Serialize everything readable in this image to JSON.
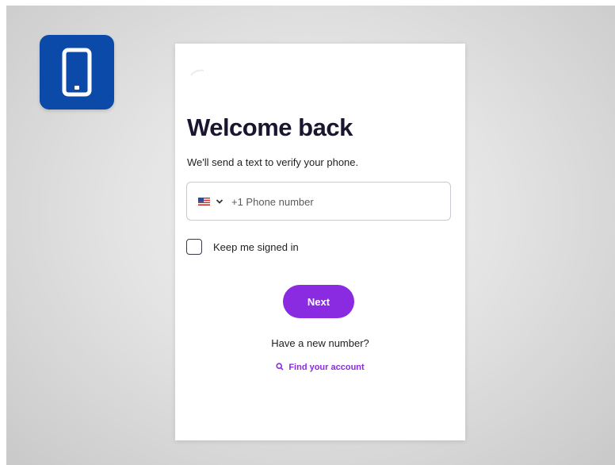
{
  "badge": {
    "icon": "smartphone-icon",
    "color": "#0b4aa8"
  },
  "login": {
    "title": "Welcome back",
    "subtitle": "We'll send a text to verify your phone.",
    "phone": {
      "country_flag": "us-flag-icon",
      "country_code": "+1",
      "placeholder": "Phone number"
    },
    "keep_signed_in": {
      "label": "Keep me signed in",
      "checked": false
    },
    "next_label": "Next",
    "new_number_prompt": "Have a new number?",
    "find_account_label": "Find your account",
    "find_account_icon": "search-icon",
    "accent_color": "#8a2be2"
  }
}
